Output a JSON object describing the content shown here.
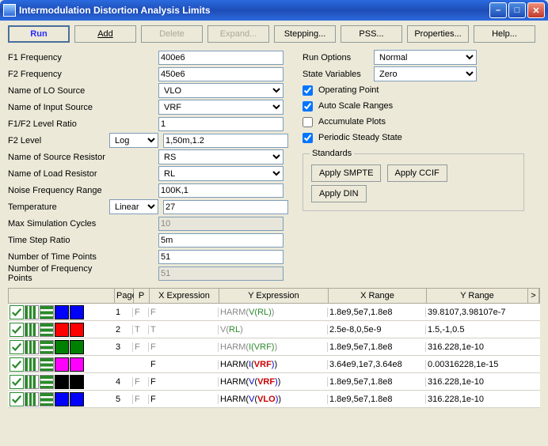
{
  "window": {
    "title": "Intermodulation Distortion Analysis Limits"
  },
  "toolbar": {
    "run": "Run",
    "add": "Add",
    "delete": "Delete",
    "expand": "Expand...",
    "stepping": "Stepping...",
    "pss": "PSS...",
    "properties": "Properties...",
    "help": "Help..."
  },
  "labels": {
    "f1freq": "F1 Frequency",
    "f2freq": "F2 Frequency",
    "losrc": "Name of LO Source",
    "insrc": "Name of Input Source",
    "ratio": "F1/F2 Level Ratio",
    "f2level": "F2 Level",
    "srcres": "Name of Source Resistor",
    "loadres": "Name of Load Resistor",
    "nfr": "Noise Frequency Range",
    "temp": "Temperature",
    "maxcyc": "Max Simulation Cycles",
    "tsr": "Time Step Ratio",
    "ntp": "Number of Time Points",
    "nfp": "Number of Frequency Points",
    "runopt": "Run Options",
    "statevar": "State Variables",
    "oppoint": "Operating Point",
    "autoscale": "Auto Scale Ranges",
    "accum": "Accumulate Plots",
    "pss": "Periodic Steady State",
    "standards": "Standards"
  },
  "values": {
    "f1freq": "400e6",
    "f2freq": "450e6",
    "losrc": "VLO",
    "insrc": "VRF",
    "ratio": "1",
    "f2levelmode": "Log",
    "f2level": "1,50m,1.2",
    "srcres": "RS",
    "loadres": "RL",
    "nfr": "100K,1",
    "tempmode": "Linear",
    "temp": "27",
    "maxcyc": "10",
    "tsr": "5m",
    "ntp": "51",
    "nfp": "51",
    "runopt": "Normal",
    "statevar": "Zero"
  },
  "checks": {
    "oppoint": true,
    "autoscale": true,
    "accum": false,
    "pss": true
  },
  "stdbuttons": {
    "smpte": "Apply SMPTE",
    "ccif": "Apply CCIF",
    "din": "Apply DIN"
  },
  "grid": {
    "headers": {
      "page": "Page",
      "p": "P",
      "xexpr": "X Expression",
      "yexpr": "Y Expression",
      "xrange": "X Range",
      "yrange": "Y Range",
      "more": ">"
    },
    "rows": [
      {
        "color1": "#0000ff",
        "color2": "#0000ff",
        "page": "1",
        "p": "F",
        "xexpr": "F",
        "xgray": true,
        "yexpr": "HARM(V(RL))",
        "ygray": true,
        "xr": "1.8e9,5e7,1.8e8",
        "yr": "39.8107,3.98107e-7"
      },
      {
        "color1": "#ff0000",
        "color2": "#ff0000",
        "page": "2",
        "p": "T",
        "xexpr": "T",
        "xgray": true,
        "yexpr": "V(RL)",
        "ygray": true,
        "xr": "2.5e-8,0,5e-9",
        "yr": "1.5,-1,0.5"
      },
      {
        "color1": "#008000",
        "color2": "#008000",
        "page": "3",
        "p": "F",
        "xexpr": "F",
        "xgray": true,
        "yexpr": "HARM(I(VRF))",
        "ygray": true,
        "xr": "1.8e9,5e7,1.8e8",
        "yr": "316.228,1e-10"
      },
      {
        "color1": "#ff00ff",
        "color2": "#ff00ff",
        "page": "",
        "p": "",
        "xexpr": "F",
        "xgray": false,
        "yexpr": "HARM(I(VRF))",
        "ygray": false,
        "xr": "3.64e9,1e7,3.64e8",
        "yr": "0.00316228,1e-15"
      },
      {
        "color1": "#000000",
        "color2": "#000000",
        "page": "4",
        "p": "F",
        "xexpr": "F",
        "xgray": false,
        "yexpr": "HARM(V(VRF))",
        "ygray": false,
        "xr": "1.8e9,5e7,1.8e8",
        "yr": "316.228,1e-10"
      },
      {
        "color1": "#0000ff",
        "color2": "#0000ff",
        "page": "5",
        "p": "F",
        "xexpr": "F",
        "xgray": false,
        "yexpr": "HARM(V(VLO))",
        "ygray": false,
        "xr": "1.8e9,5e7,1.8e8",
        "yr": "316.228,1e-10"
      }
    ]
  }
}
